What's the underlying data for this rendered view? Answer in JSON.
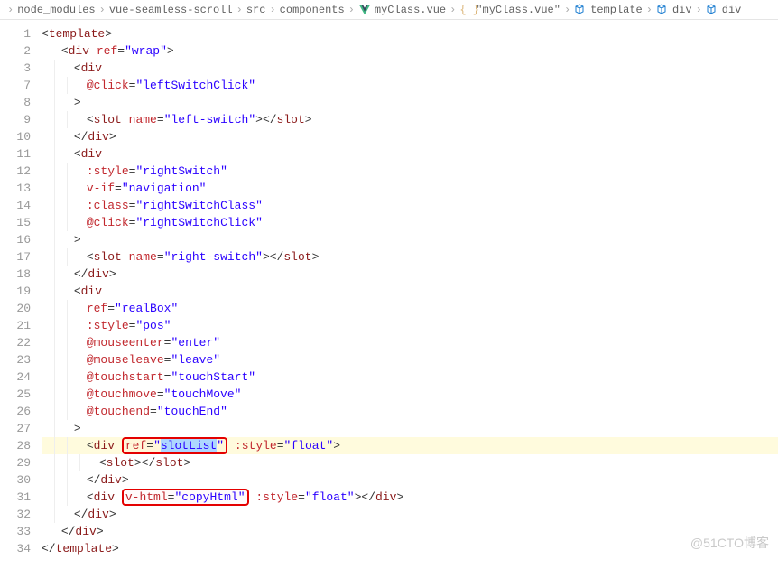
{
  "breadcrumb": [
    {
      "label": "",
      "icon": ""
    },
    {
      "label": "node_modules",
      "icon": ""
    },
    {
      "label": "vue-seamless-scroll",
      "icon": ""
    },
    {
      "label": "src",
      "icon": ""
    },
    {
      "label": "components",
      "icon": ""
    },
    {
      "label": "myClass.vue",
      "icon": "vue"
    },
    {
      "label": "\"myClass.vue\"",
      "icon": "json"
    },
    {
      "label": "template",
      "icon": "cube"
    },
    {
      "label": "div",
      "icon": "cube"
    },
    {
      "label": "div",
      "icon": "cube"
    }
  ],
  "line_numbers": [
    "1",
    "2",
    "3",
    "7",
    "8",
    "9",
    "10",
    "11",
    "12",
    "13",
    "14",
    "15",
    "16",
    "17",
    "18",
    "19",
    "20",
    "21",
    "22",
    "23",
    "24",
    "25",
    "26",
    "27",
    "28",
    "29",
    "30",
    "31",
    "32",
    "33",
    "34"
  ],
  "code": {
    "l1": {
      "tag": "template"
    },
    "l2": {
      "tag": "div",
      "attr": "ref",
      "val": "wrap"
    },
    "l3": {
      "tag": "div"
    },
    "l7": {
      "attr": "@click",
      "val": "leftSwitchClick"
    },
    "l9": {
      "tag": "slot",
      "attr": "name",
      "val": "left-switch",
      "close": "slot"
    },
    "l10": {
      "tag": "div"
    },
    "l11": {
      "tag": "div"
    },
    "l12": {
      "attr": ":style",
      "val": "rightSwitch"
    },
    "l13": {
      "attr": "v-if",
      "val": "navigation"
    },
    "l14": {
      "attr": ":class",
      "val": "rightSwitchClass"
    },
    "l15": {
      "attr": "@click",
      "val": "rightSwitchClick"
    },
    "l17": {
      "tag": "slot",
      "attr": "name",
      "val": "right-switch",
      "close": "slot"
    },
    "l18": {
      "tag": "div"
    },
    "l19": {
      "tag": "div"
    },
    "l20": {
      "attr": "ref",
      "val": "realBox"
    },
    "l21": {
      "attr": ":style",
      "val": "pos"
    },
    "l22": {
      "attr": "@mouseenter",
      "val": "enter"
    },
    "l23": {
      "attr": "@mouseleave",
      "val": "leave"
    },
    "l24": {
      "attr": "@touchstart",
      "val": "touchStart"
    },
    "l25": {
      "attr": "@touchmove",
      "val": "touchMove"
    },
    "l26": {
      "attr": "@touchend",
      "val": "touchEnd"
    },
    "l28": {
      "tag": "div",
      "attr1": "ref",
      "val1": "slotList",
      "attr2": ":style",
      "val2": "float"
    },
    "l29": {
      "tag": "slot",
      "close": "slot"
    },
    "l30": {
      "tag": "div"
    },
    "l31": {
      "tag": "div",
      "attr1": "v-html",
      "val1": "copyHtml",
      "attr2": ":style",
      "val2": "float",
      "close": "div"
    },
    "l32": {
      "tag": "div"
    },
    "l33": {
      "tag": "div"
    },
    "l34": {
      "tag": "template"
    }
  },
  "watermark": "@51CTO博客"
}
